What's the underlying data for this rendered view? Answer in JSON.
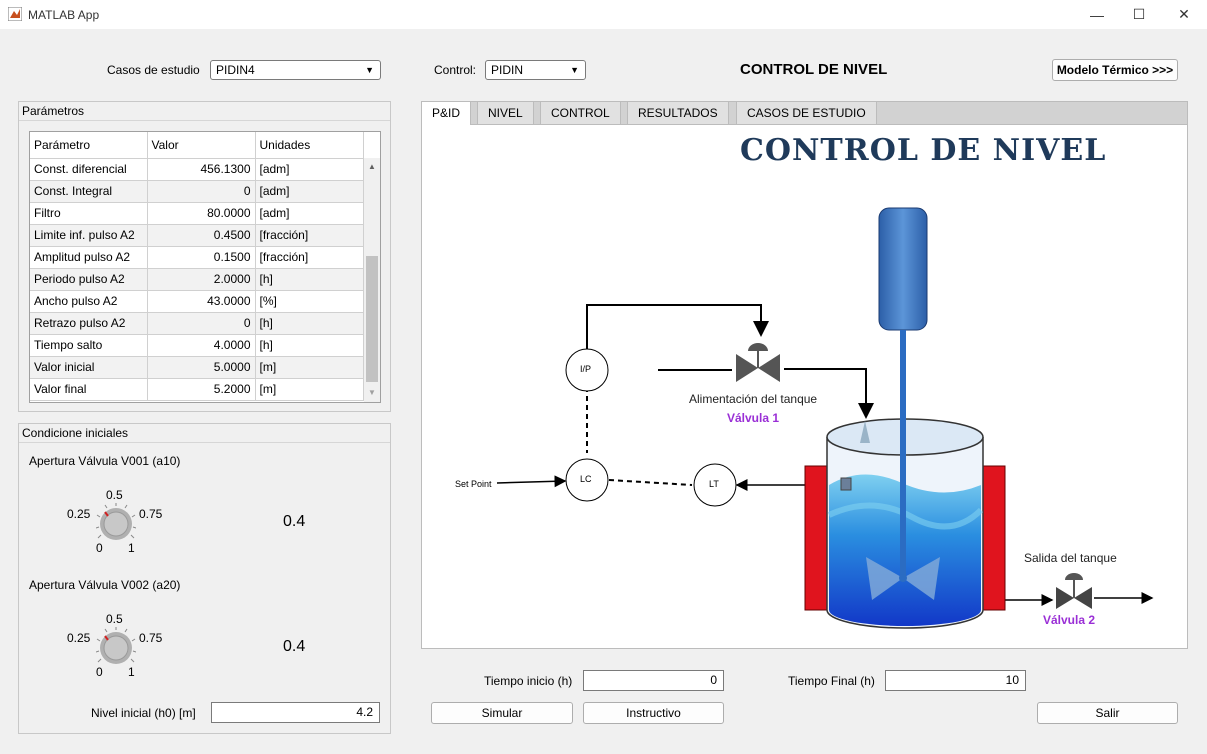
{
  "window": {
    "title": "MATLAB App",
    "minimize": "—",
    "maximize": "☐",
    "close": "✕"
  },
  "header": {
    "casos_label": "Casos de estudio",
    "casos_value": "PIDIN4",
    "control_label": "Control:",
    "control_value": "PIDIN",
    "main_title": "CONTROL DE NIVEL",
    "modelo_button": "Modelo Térmico >>>"
  },
  "parametros": {
    "title": "Parámetros",
    "columns": [
      "Parámetro",
      "Valor",
      "Unidades"
    ],
    "rows": [
      [
        "Const. diferencial",
        "456.1300",
        "[adm]"
      ],
      [
        "Const. Integral",
        "0",
        "[adm]"
      ],
      [
        "Filtro",
        "80.0000",
        "[adm]"
      ],
      [
        "Limite inf. pulso A2",
        "0.4500",
        "[fracción]"
      ],
      [
        "Amplitud pulso A2",
        "0.1500",
        "[fracción]"
      ],
      [
        "Periodo pulso A2",
        "2.0000",
        "[h]"
      ],
      [
        "Ancho pulso A2",
        "43.0000",
        "[%]"
      ],
      [
        "Retrazo pulso A2",
        "0",
        "[h]"
      ],
      [
        "Tiempo salto",
        "4.0000",
        "[h]"
      ],
      [
        "Valor inicial",
        "5.0000",
        "[m]"
      ],
      [
        "Valor final",
        "5.2000",
        "[m]"
      ]
    ]
  },
  "condiciones": {
    "title": "Condicione iniciales",
    "v1_label": "Apertura Válvula V001 (a10)",
    "v1_value": "0.4",
    "v2_label": "Apertura Válvula V002 (a20)",
    "v2_value": "0.4",
    "knob_ticks": {
      "t0": "0",
      "t025": "0.25",
      "t05": "0.5",
      "t075": "0.75",
      "t1": "1"
    },
    "nivel_label": "Nivel inicial (h0) [m]",
    "nivel_value": "4.2"
  },
  "tabs": [
    "P&ID",
    "NIVEL",
    "CONTROL",
    "RESULTADOS",
    "CASOS DE ESTUDIO"
  ],
  "diagram": {
    "title": "CONTROL DE NIVEL",
    "ip": "I/P",
    "lc": "LC",
    "lt": "LT",
    "setpoint": "Set Point",
    "alimentacion": "Alimentación del tanque",
    "valvula1": "Válvula 1",
    "salida": "Salida del tanque",
    "valvula2": "Válvula 2"
  },
  "bottom": {
    "tiempo_inicio_label": "Tiempo inicio (h)",
    "tiempo_inicio_value": "0",
    "tiempo_final_label": "Tiempo Final (h)",
    "tiempo_final_value": "10",
    "simular": "Simular",
    "instructivo": "Instructivo",
    "salir": "Salir"
  },
  "colors": {
    "title_navy": "#1f3a5a",
    "valve_label": "#9a2fd6",
    "tank_red": "#e0141e",
    "water_blue": "#1d63d6"
  }
}
